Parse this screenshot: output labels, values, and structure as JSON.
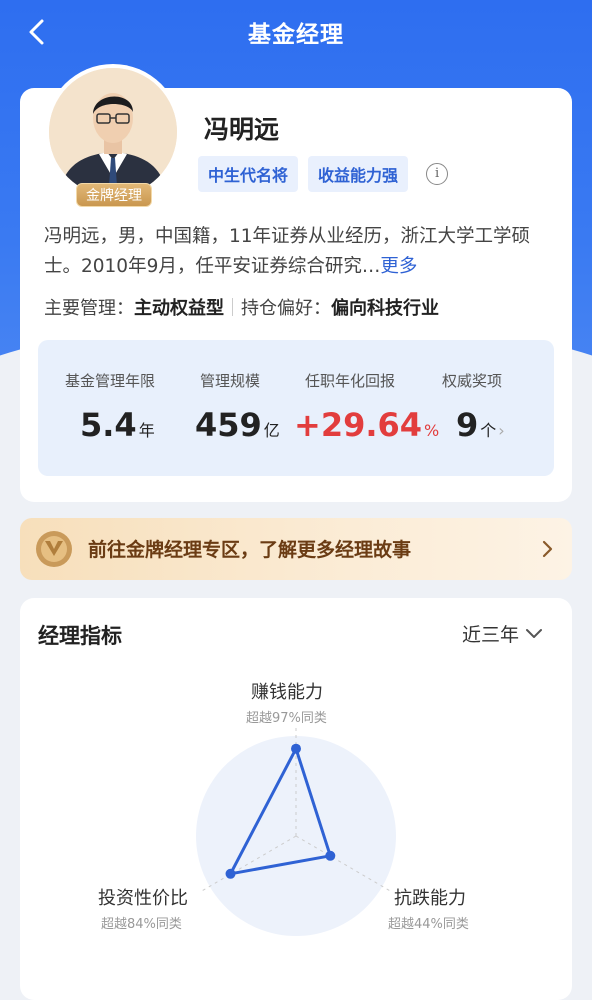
{
  "header": {
    "title": "基金经理"
  },
  "manager": {
    "badge": "金牌经理",
    "name": "冯明远",
    "tags": [
      "中生代名将",
      "收益能力强"
    ],
    "bio": "冯明远，男，中国籍，11年证券从业经历，浙江大学工学硕士。2010年9月，任平安证券综合研究…",
    "bio_more": "更多",
    "focus_label_1": "主要管理：",
    "focus_value_1": "主动权益型",
    "focus_label_2": "持仓偏好：",
    "focus_value_2": "偏向科技行业"
  },
  "stats": [
    {
      "label": "基金管理年限",
      "value": "5.4",
      "unit": "年"
    },
    {
      "label": "管理规模",
      "value": "459",
      "unit": "亿"
    },
    {
      "label": "任职年化回报",
      "value": "+29.64",
      "unit": "%"
    },
    {
      "label": "权威奖项",
      "value": "9",
      "unit": "个"
    }
  ],
  "banner": {
    "text": "前往金牌经理专区，了解更多经理故事"
  },
  "metrics": {
    "title": "经理指标",
    "period": "近三年",
    "axes": [
      {
        "label": "赚钱能力",
        "sub": "超越97%同类",
        "percent": 97
      },
      {
        "label": "抗跌能力",
        "sub": "超越44%同类",
        "percent": 44
      },
      {
        "label": "投资性价比",
        "sub": "超越84%同类",
        "percent": 84
      }
    ]
  },
  "colors": {
    "brand_blue": "#2e6ef0",
    "return_red": "#e23d3d",
    "radar_line": "#2f62d4"
  }
}
